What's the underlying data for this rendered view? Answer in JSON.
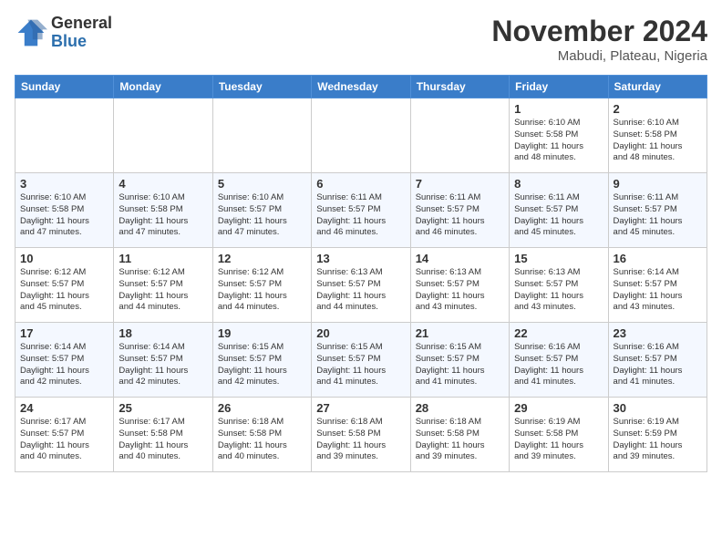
{
  "header": {
    "logo_general": "General",
    "logo_blue": "Blue",
    "month_title": "November 2024",
    "location": "Mabudi, Plateau, Nigeria"
  },
  "days_of_week": [
    "Sunday",
    "Monday",
    "Tuesday",
    "Wednesday",
    "Thursday",
    "Friday",
    "Saturday"
  ],
  "weeks": [
    [
      {
        "day": "",
        "info": ""
      },
      {
        "day": "",
        "info": ""
      },
      {
        "day": "",
        "info": ""
      },
      {
        "day": "",
        "info": ""
      },
      {
        "day": "",
        "info": ""
      },
      {
        "day": "1",
        "info": "Sunrise: 6:10 AM\nSunset: 5:58 PM\nDaylight: 11 hours\nand 48 minutes."
      },
      {
        "day": "2",
        "info": "Sunrise: 6:10 AM\nSunset: 5:58 PM\nDaylight: 11 hours\nand 48 minutes."
      }
    ],
    [
      {
        "day": "3",
        "info": "Sunrise: 6:10 AM\nSunset: 5:58 PM\nDaylight: 11 hours\nand 47 minutes."
      },
      {
        "day": "4",
        "info": "Sunrise: 6:10 AM\nSunset: 5:58 PM\nDaylight: 11 hours\nand 47 minutes."
      },
      {
        "day": "5",
        "info": "Sunrise: 6:10 AM\nSunset: 5:57 PM\nDaylight: 11 hours\nand 47 minutes."
      },
      {
        "day": "6",
        "info": "Sunrise: 6:11 AM\nSunset: 5:57 PM\nDaylight: 11 hours\nand 46 minutes."
      },
      {
        "day": "7",
        "info": "Sunrise: 6:11 AM\nSunset: 5:57 PM\nDaylight: 11 hours\nand 46 minutes."
      },
      {
        "day": "8",
        "info": "Sunrise: 6:11 AM\nSunset: 5:57 PM\nDaylight: 11 hours\nand 45 minutes."
      },
      {
        "day": "9",
        "info": "Sunrise: 6:11 AM\nSunset: 5:57 PM\nDaylight: 11 hours\nand 45 minutes."
      }
    ],
    [
      {
        "day": "10",
        "info": "Sunrise: 6:12 AM\nSunset: 5:57 PM\nDaylight: 11 hours\nand 45 minutes."
      },
      {
        "day": "11",
        "info": "Sunrise: 6:12 AM\nSunset: 5:57 PM\nDaylight: 11 hours\nand 44 minutes."
      },
      {
        "day": "12",
        "info": "Sunrise: 6:12 AM\nSunset: 5:57 PM\nDaylight: 11 hours\nand 44 minutes."
      },
      {
        "day": "13",
        "info": "Sunrise: 6:13 AM\nSunset: 5:57 PM\nDaylight: 11 hours\nand 44 minutes."
      },
      {
        "day": "14",
        "info": "Sunrise: 6:13 AM\nSunset: 5:57 PM\nDaylight: 11 hours\nand 43 minutes."
      },
      {
        "day": "15",
        "info": "Sunrise: 6:13 AM\nSunset: 5:57 PM\nDaylight: 11 hours\nand 43 minutes."
      },
      {
        "day": "16",
        "info": "Sunrise: 6:14 AM\nSunset: 5:57 PM\nDaylight: 11 hours\nand 43 minutes."
      }
    ],
    [
      {
        "day": "17",
        "info": "Sunrise: 6:14 AM\nSunset: 5:57 PM\nDaylight: 11 hours\nand 42 minutes."
      },
      {
        "day": "18",
        "info": "Sunrise: 6:14 AM\nSunset: 5:57 PM\nDaylight: 11 hours\nand 42 minutes."
      },
      {
        "day": "19",
        "info": "Sunrise: 6:15 AM\nSunset: 5:57 PM\nDaylight: 11 hours\nand 42 minutes."
      },
      {
        "day": "20",
        "info": "Sunrise: 6:15 AM\nSunset: 5:57 PM\nDaylight: 11 hours\nand 41 minutes."
      },
      {
        "day": "21",
        "info": "Sunrise: 6:15 AM\nSunset: 5:57 PM\nDaylight: 11 hours\nand 41 minutes."
      },
      {
        "day": "22",
        "info": "Sunrise: 6:16 AM\nSunset: 5:57 PM\nDaylight: 11 hours\nand 41 minutes."
      },
      {
        "day": "23",
        "info": "Sunrise: 6:16 AM\nSunset: 5:57 PM\nDaylight: 11 hours\nand 41 minutes."
      }
    ],
    [
      {
        "day": "24",
        "info": "Sunrise: 6:17 AM\nSunset: 5:57 PM\nDaylight: 11 hours\nand 40 minutes."
      },
      {
        "day": "25",
        "info": "Sunrise: 6:17 AM\nSunset: 5:58 PM\nDaylight: 11 hours\nand 40 minutes."
      },
      {
        "day": "26",
        "info": "Sunrise: 6:18 AM\nSunset: 5:58 PM\nDaylight: 11 hours\nand 40 minutes."
      },
      {
        "day": "27",
        "info": "Sunrise: 6:18 AM\nSunset: 5:58 PM\nDaylight: 11 hours\nand 39 minutes."
      },
      {
        "day": "28",
        "info": "Sunrise: 6:18 AM\nSunset: 5:58 PM\nDaylight: 11 hours\nand 39 minutes."
      },
      {
        "day": "29",
        "info": "Sunrise: 6:19 AM\nSunset: 5:58 PM\nDaylight: 11 hours\nand 39 minutes."
      },
      {
        "day": "30",
        "info": "Sunrise: 6:19 AM\nSunset: 5:59 PM\nDaylight: 11 hours\nand 39 minutes."
      }
    ]
  ]
}
